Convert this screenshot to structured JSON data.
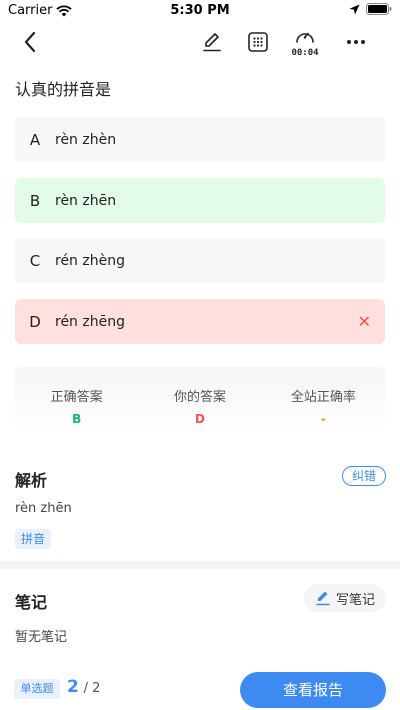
{
  "status_bar": {
    "carrier": "Carrier",
    "time": "5:30 PM"
  },
  "nav": {
    "icons": [
      "back-chevron-icon",
      "edit-pen-icon",
      "answer-sheet-grid-icon",
      "timer-icon",
      "more-icon"
    ],
    "timer": "00:04"
  },
  "question": {
    "text": "认真的拼音是"
  },
  "options": [
    {
      "letter": "A",
      "text": "rèn zhèn",
      "state": "normal"
    },
    {
      "letter": "B",
      "text": "rèn zhēn",
      "state": "correct"
    },
    {
      "letter": "C",
      "text": "rén zhèng",
      "state": "normal"
    },
    {
      "letter": "D",
      "text": "rén zhēng",
      "state": "wrong"
    }
  ],
  "stats": {
    "correct_label": "正确答案",
    "correct_value": "B",
    "yours_label": "你的答案",
    "yours_value": "D",
    "rate_label": "全站正确率",
    "rate_value": "-"
  },
  "analysis": {
    "title": "解析",
    "report_label": "纠错",
    "text": "rèn zhēn",
    "tag": "拼音"
  },
  "notes": {
    "title": "笔记",
    "write_label": "写笔记",
    "empty_text": "暂无笔记"
  },
  "footer": {
    "question_type": "单选题",
    "current": "2",
    "total": "/ 2",
    "report_button": "查看报告"
  },
  "colors": {
    "accent": "#3d8bf0",
    "correct": "#19b36b",
    "wrong": "#f0524d",
    "rate": "#f08a3c",
    "correct_bg": "#e3fbe9",
    "wrong_bg": "#ffe0df"
  }
}
